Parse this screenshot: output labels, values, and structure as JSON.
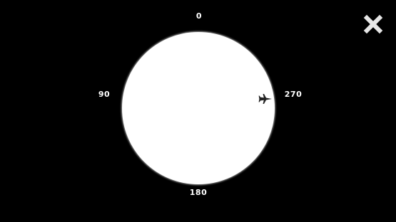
{
  "compass": {
    "labels": {
      "north": "0",
      "west": "90",
      "east": "270",
      "south": "180"
    },
    "pointer_icon": "airplane-icon",
    "dial_color": "#ffffff",
    "background_color": "#000000"
  },
  "controls": {
    "close_icon": "close-icon",
    "close_color": "#e6e6e6"
  }
}
